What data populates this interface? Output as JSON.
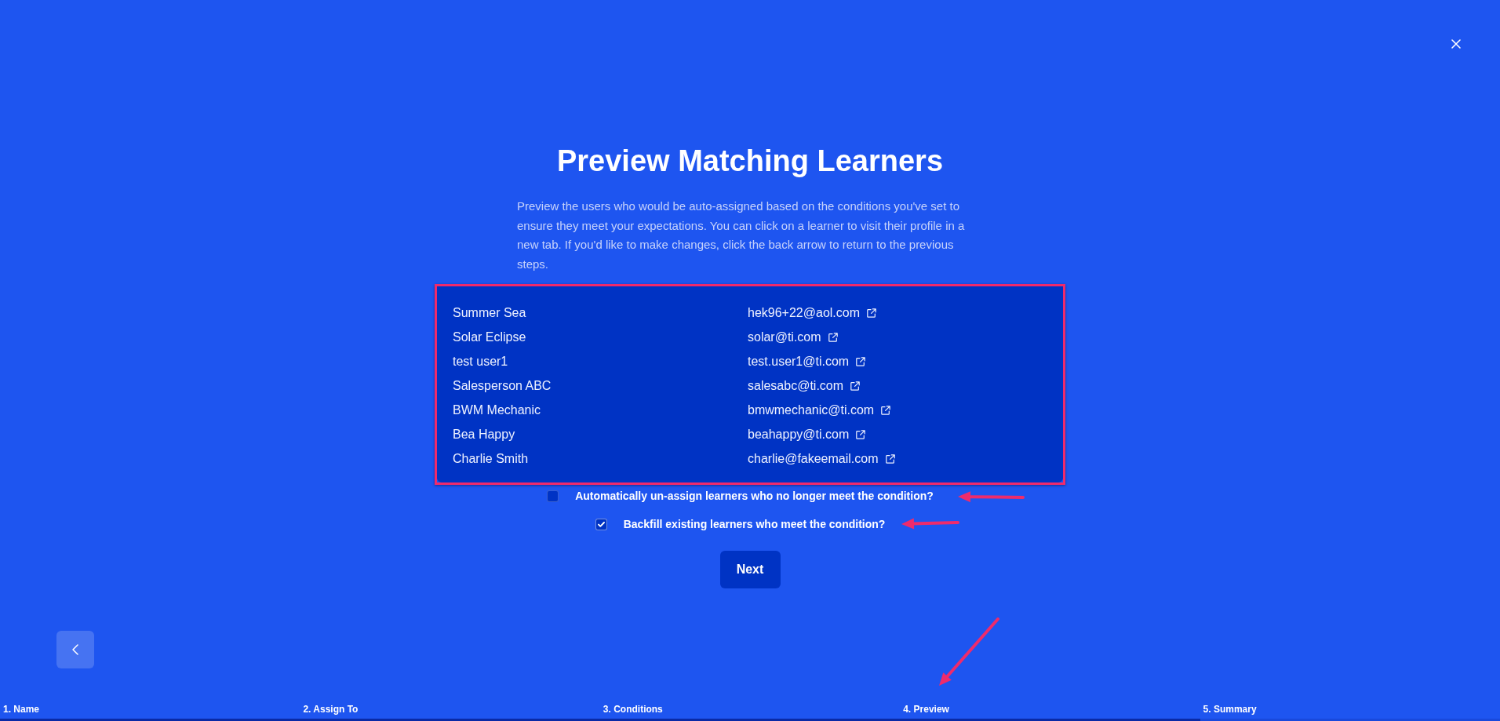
{
  "title": "Preview Matching Learners",
  "description": "Preview the users who would be auto-assigned based on the conditions you've set to ensure they meet your expectations. You can click on a learner to visit their profile in a new tab. If you'd like to make changes, click the back arrow to return to the previous steps.",
  "learners": [
    {
      "name": "Summer Sea",
      "email": "hek96+22@aol.com"
    },
    {
      "name": "Solar Eclipse",
      "email": "solar@ti.com"
    },
    {
      "name": "test user1",
      "email": "test.user1@ti.com"
    },
    {
      "name": "Salesperson ABC",
      "email": "salesabc@ti.com"
    },
    {
      "name": "BWM Mechanic",
      "email": "bmwmechanic@ti.com"
    },
    {
      "name": "Bea Happy",
      "email": "beahappy@ti.com"
    },
    {
      "name": "Charlie Smith",
      "email": "charlie@fakeemail.com"
    }
  ],
  "options": [
    {
      "label": "Automatically un-assign learners who no longer meet the condition?",
      "checked": false
    },
    {
      "label": "Backfill existing learners who meet the condition?",
      "checked": true
    }
  ],
  "next_button": "Next",
  "steps": [
    "1. Name",
    "2. Assign To",
    "3. Conditions",
    "4. Preview",
    "5. Summary"
  ],
  "progress": {
    "level": 0.8
  }
}
